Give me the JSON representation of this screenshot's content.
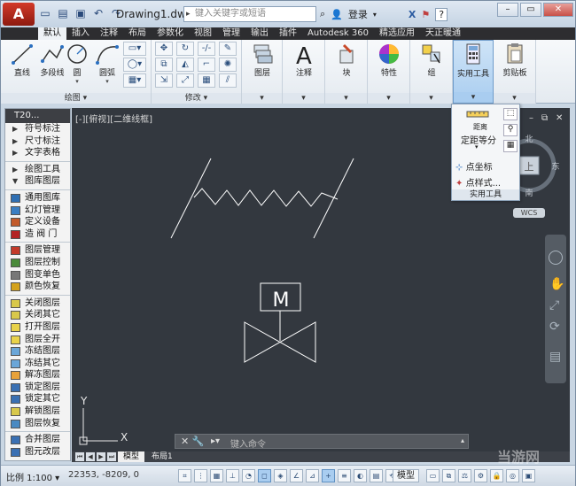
{
  "title_bar": {
    "app_button": "A",
    "document_title": "Drawing1.dwg",
    "search_placeholder": "键入关键字或短语",
    "login_label": "登录",
    "help_label": "?"
  },
  "ribbon_tabs": [
    "默认",
    "插入",
    "注释",
    "布局",
    "参数化",
    "视图",
    "管理",
    "输出",
    "插件",
    "Autodesk 360",
    "精选应用",
    "天正暖通"
  ],
  "ribbon": {
    "draw_panel": {
      "label": "绘图",
      "tools": [
        {
          "label": "直线",
          "icon": "line-icon"
        },
        {
          "label": "多段线",
          "icon": "polyline-icon"
        },
        {
          "label": "圆",
          "icon": "circle-icon"
        },
        {
          "label": "圆弧",
          "icon": "arc-icon"
        }
      ]
    },
    "modify_panel": {
      "label": "修改"
    },
    "big_buttons": [
      {
        "label": "图层",
        "icon": "layer-icon"
      },
      {
        "label": "注释",
        "icon": "text-icon"
      },
      {
        "label": "块",
        "icon": "block-icon"
      },
      {
        "label": "特性",
        "icon": "color-wheel-icon"
      },
      {
        "label": "组",
        "icon": "group-icon"
      },
      {
        "label": "实用工具",
        "icon": "calculator-icon"
      },
      {
        "label": "剪贴板",
        "icon": "clipboard-icon"
      }
    ]
  },
  "utility_dropdown": {
    "measure_label": "距离",
    "divide_label": "定距等分",
    "point_coord_label": "点坐标",
    "point_style_label": "点样式...",
    "footer_label": "实用工具"
  },
  "viewport": {
    "label": "[-][俯视][二维线框]",
    "viewcube": {
      "top": "上",
      "north": "北",
      "south": "南",
      "east": "东",
      "west": "西",
      "wcs": "WCS"
    }
  },
  "left_palette": {
    "title": "T20...",
    "items": [
      {
        "label": "符号标注",
        "type": "arrow"
      },
      {
        "label": "尺寸标注",
        "type": "arrow"
      },
      {
        "label": "文字表格",
        "type": "arrow"
      },
      {
        "label": "绘图工具",
        "type": "arrow"
      },
      {
        "label": "图库图层",
        "type": "arrow-open"
      },
      {
        "label": "通用图库",
        "type": "icon",
        "color": "#2f6fb3"
      },
      {
        "label": "幻灯管理",
        "type": "icon",
        "color": "#3a7ec2"
      },
      {
        "label": "定义设备",
        "type": "icon",
        "color": "#c25a2a"
      },
      {
        "label": "造 阀 门",
        "type": "icon",
        "color": "#b32424"
      },
      {
        "label": "图层管理",
        "type": "icon",
        "color": "#c23a2a"
      },
      {
        "label": "图层控制",
        "type": "icon",
        "color": "#4a8a3a"
      },
      {
        "label": "图变单色",
        "type": "icon",
        "color": "#777777"
      },
      {
        "label": "颜色恢复",
        "type": "icon",
        "color": "#d4a21c"
      },
      {
        "label": "关闭图层",
        "type": "icon",
        "color": "#d8c84a"
      },
      {
        "label": "关闭其它",
        "type": "icon",
        "color": "#d8c84a"
      },
      {
        "label": "打开图层",
        "type": "icon",
        "color": "#e8d24a"
      },
      {
        "label": "图层全开",
        "type": "icon",
        "color": "#e8d24a"
      },
      {
        "label": "冻结图层",
        "type": "icon",
        "color": "#6aa6d8"
      },
      {
        "label": "冻结其它",
        "type": "icon",
        "color": "#6aa6d8"
      },
      {
        "label": "解冻图层",
        "type": "icon",
        "color": "#e8a23a"
      },
      {
        "label": "锁定图层",
        "type": "icon",
        "color": "#3a70b3"
      },
      {
        "label": "锁定其它",
        "type": "icon",
        "color": "#3a70b3"
      },
      {
        "label": "解锁图层",
        "type": "icon",
        "color": "#d8c84a"
      },
      {
        "label": "图层恢复",
        "type": "icon",
        "color": "#4a8ac2"
      },
      {
        "label": "合并图层",
        "type": "icon",
        "color": "#3a70b3"
      },
      {
        "label": "图元改层",
        "type": "icon",
        "color": "#3a70b3"
      }
    ]
  },
  "drawing": {
    "symbol_letter": "M",
    "axis_x": "X",
    "axis_y": "Y"
  },
  "command_line": {
    "placeholder": "键入命令"
  },
  "layout_tabs": [
    "模型",
    "布局1"
  ],
  "status_bar": {
    "scale": "比例 1:100",
    "coords": "22353, -8209, 0",
    "model_label": "模型"
  },
  "watermark": "当游网"
}
